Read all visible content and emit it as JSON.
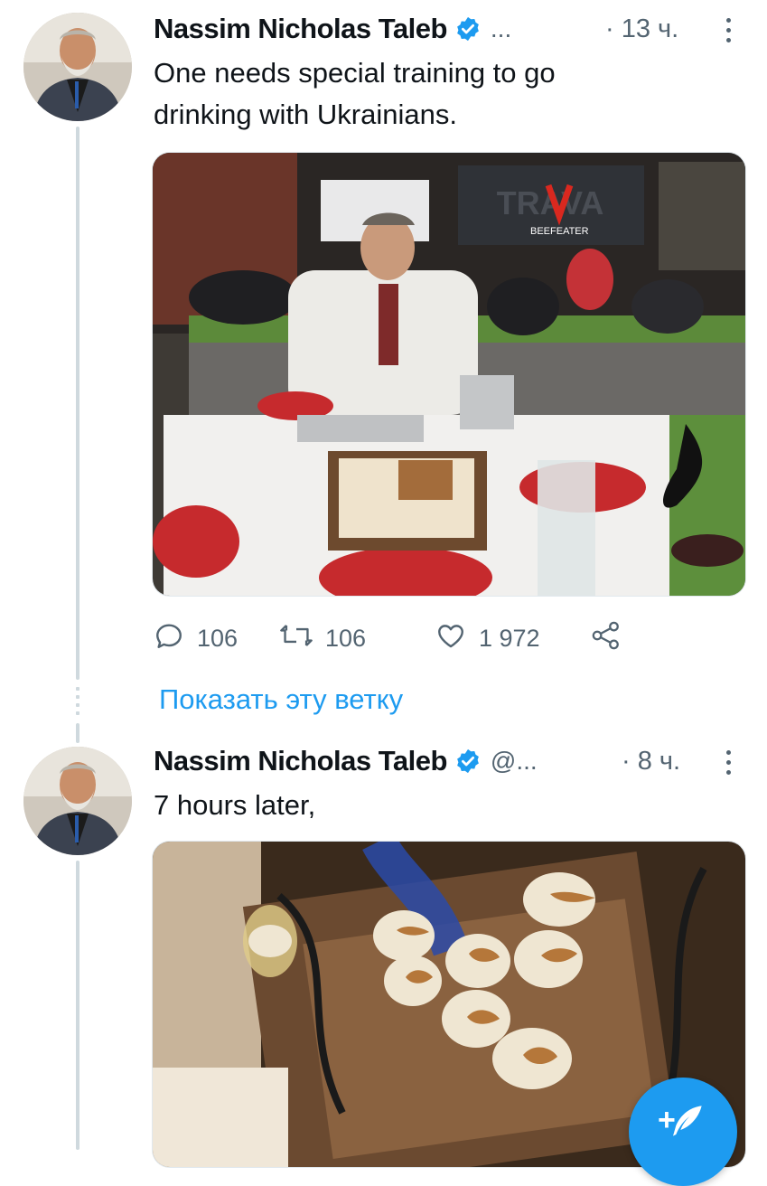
{
  "tweets": [
    {
      "author": "Nassim Nicholas Taleb",
      "handle": "...",
      "time": "· 13 ч.",
      "text_line1": "One needs special training to go",
      "text_line2": "drinking with Ukrainians.",
      "image_sign_brand": "TRAVA",
      "image_sign_sponsor": "BEEFEATER",
      "replies": "106",
      "retweets": "106",
      "likes": "1 972"
    },
    {
      "author": "Nassim Nicholas Taleb",
      "handle": "@...",
      "time": "· 8 ч.",
      "text_line1": "7 hours later,"
    }
  ],
  "show_thread": "Показать эту ветку",
  "icons": {
    "verified": "verified-badge-icon",
    "more": "more-vertical-icon",
    "reply": "reply-icon",
    "retweet": "retweet-icon",
    "like": "heart-icon",
    "share": "share-icon",
    "compose": "compose-tweet-icon"
  },
  "compose_plus": "+",
  "colors": {
    "accent": "#1d9bf0",
    "text": "#0f1419",
    "muted": "#536471",
    "line": "#cfd9de"
  }
}
